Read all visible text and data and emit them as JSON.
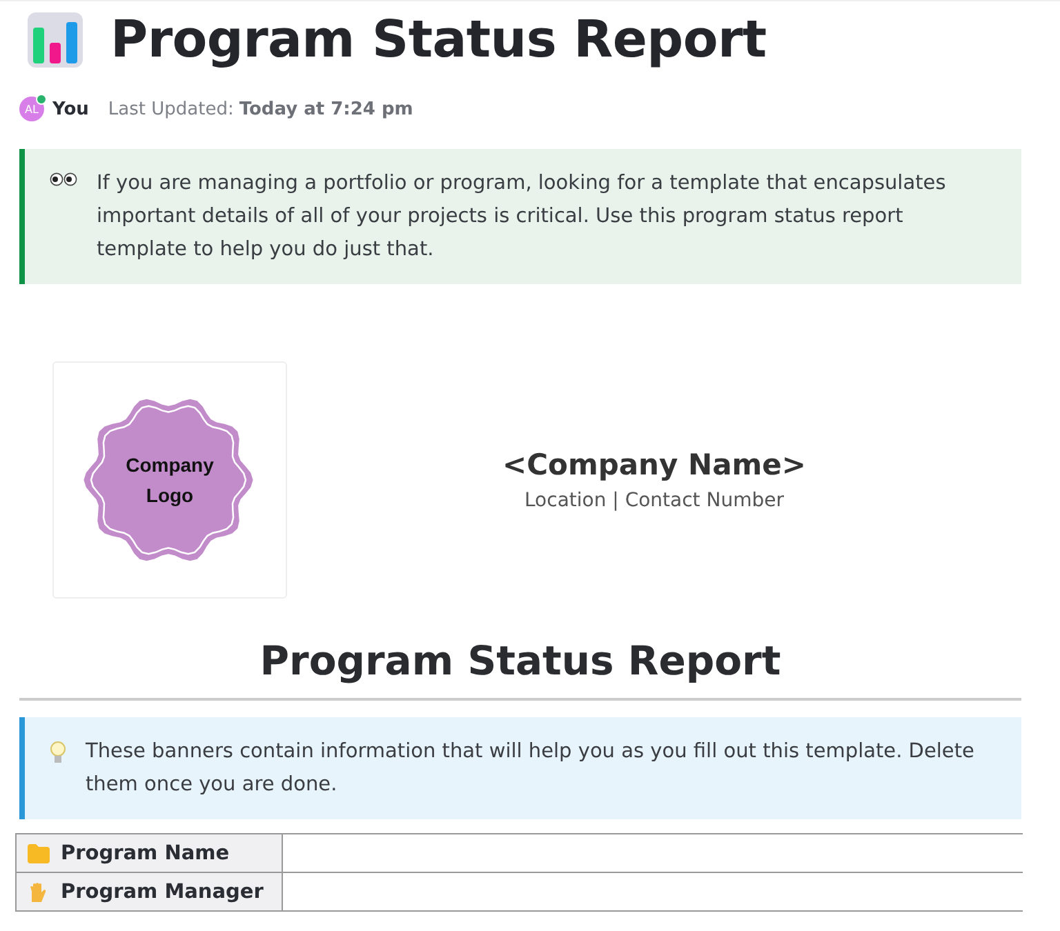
{
  "title": "Program Status Report",
  "meta": {
    "avatar": "AL",
    "online": true,
    "author": "You",
    "updated_label": "Last Updated:",
    "updated_value": "Today at 7:24 pm"
  },
  "callouts": [
    {
      "kind": "eyes",
      "text": "If you are managing a portfolio or program, looking for a template that encapsulates important details of all of your projects is critical. Use this program status report template to help you do just that."
    }
  ],
  "header": {
    "logo_text": "Company Logo",
    "company_name": "<Company Name>",
    "subtitle": "Location | Contact Number"
  },
  "report_heading": "Program Status Report",
  "banners": [
    {
      "kind": "bulb",
      "text": "These banners contain information that will help you as you fill out this template. Delete them once you are done."
    }
  ],
  "table": {
    "rows": [
      {
        "kind": "folder",
        "label": "Program Name"
      },
      {
        "kind": "hand",
        "label": "Program Manager"
      }
    ]
  }
}
